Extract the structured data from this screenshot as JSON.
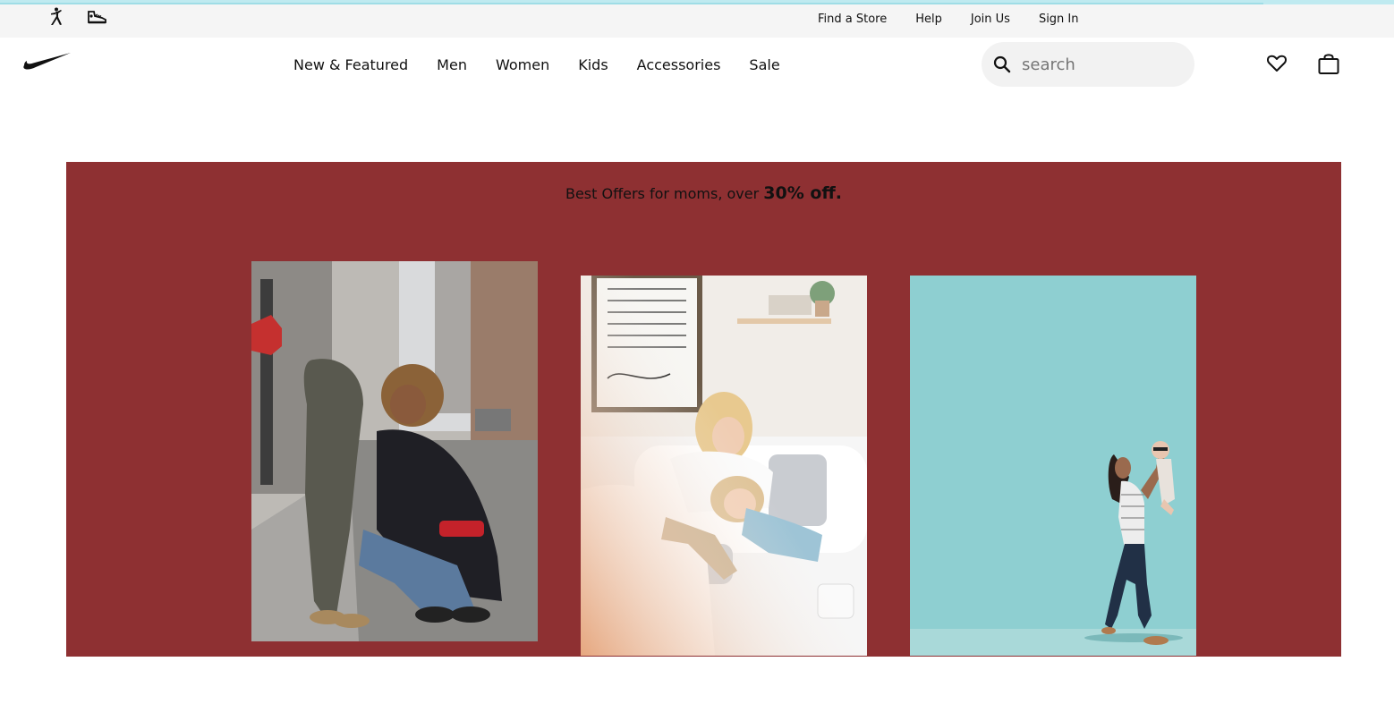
{
  "utility_bar": {
    "brand_icons": [
      "jordan-logo-icon",
      "converse-sneaker-icon"
    ],
    "links": [
      "Find a Store",
      "Help",
      "Join Us",
      "Sign In"
    ]
  },
  "nav": {
    "logo_icon": "swoosh-logo-icon",
    "menu": [
      "New & Featured",
      "Men",
      "Women",
      "Kids",
      "Accessories",
      "Sale"
    ],
    "search": {
      "placeholder": "search",
      "value": ""
    },
    "icons": [
      "heart-icon",
      "shopping-bag-icon"
    ]
  },
  "promo": {
    "background_color": "#8e3032",
    "heading_prefix": "Best Offers for moms, over ",
    "heading_highlight": "30% off.",
    "images": [
      {
        "name": "mother-child-street-photo"
      },
      {
        "name": "mother-child-sofa-photo"
      },
      {
        "name": "mother-lifting-baby-photo"
      }
    ]
  }
}
